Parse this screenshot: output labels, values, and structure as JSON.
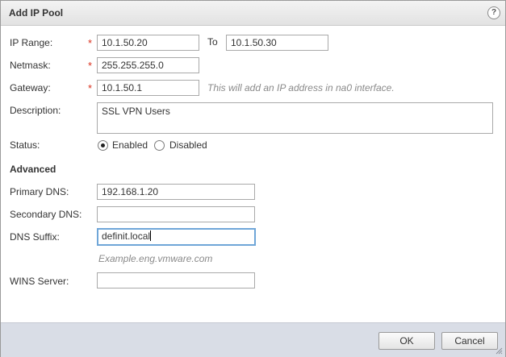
{
  "dialog": {
    "title": "Add IP Pool",
    "help_glyph": "?"
  },
  "form": {
    "required_mark": "*",
    "ip_range": {
      "label": "IP Range:",
      "from": "10.1.50.20",
      "to_label": "To",
      "to": "10.1.50.30"
    },
    "netmask": {
      "label": "Netmask:",
      "value": "255.255.255.0"
    },
    "gateway": {
      "label": "Gateway:",
      "value": "10.1.50.1",
      "hint": "This will add an IP address in na0 interface."
    },
    "description": {
      "label": "Description:",
      "value": "SSL VPN Users"
    },
    "status": {
      "label": "Status:",
      "options": [
        "Enabled",
        "Disabled"
      ],
      "selected": "Enabled"
    }
  },
  "advanced": {
    "heading": "Advanced",
    "primary_dns": {
      "label": "Primary DNS:",
      "value": "192.168.1.20"
    },
    "secondary_dns": {
      "label": "Secondary DNS:",
      "value": ""
    },
    "dns_suffix": {
      "label": "DNS Suffix:",
      "value": "definit.local",
      "hint": "Example.eng.vmware.com"
    },
    "wins_server": {
      "label": "WINS Server:",
      "value": ""
    }
  },
  "footer": {
    "ok_label": "OK",
    "cancel_label": "Cancel"
  },
  "colors": {
    "required": "#d9301d",
    "footer_bg": "#d9dde6",
    "focus_border": "#6fa6d8"
  }
}
